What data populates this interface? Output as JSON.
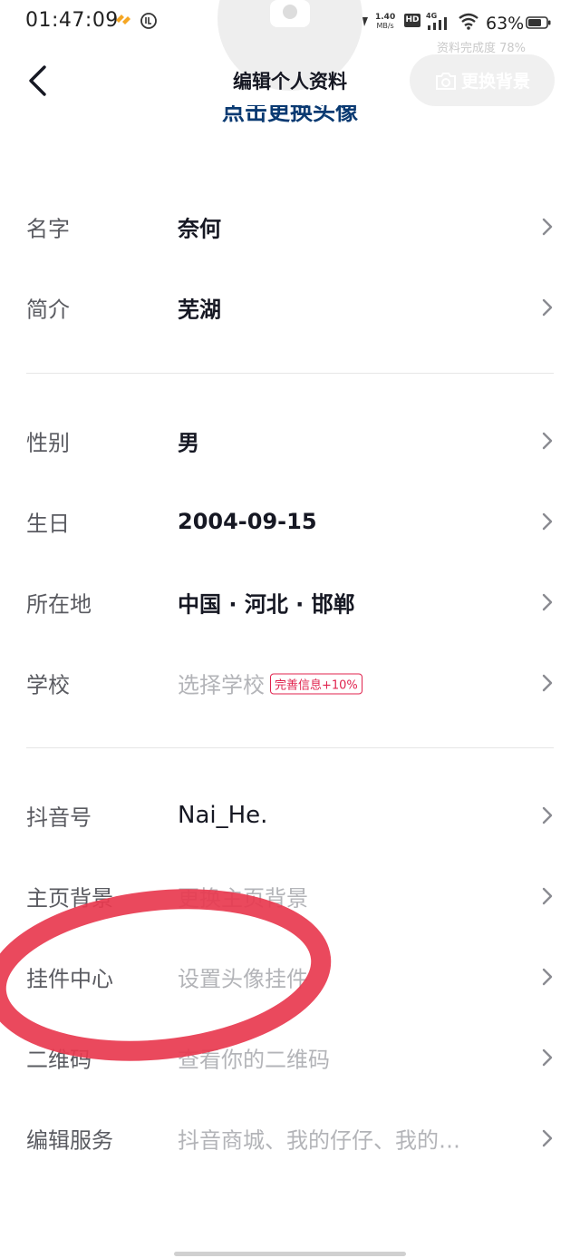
{
  "status_bar": {
    "time": "01:47:09",
    "net_speed_value": "1.40",
    "net_speed_unit": "MB/s",
    "hd": "HD",
    "net_type": "4G",
    "battery": "63%"
  },
  "header": {
    "title": "编辑个人资料",
    "change_bg_button": "更换背景",
    "completion": "资料完成度 78%",
    "change_avatar": "点击更换头像"
  },
  "profile": {
    "name": {
      "label": "名字",
      "value": "奈何"
    },
    "bio": {
      "label": "简介",
      "value": "芜湖"
    },
    "gender": {
      "label": "性别",
      "value": "男"
    },
    "birthday": {
      "label": "生日",
      "value": "2004-09-15"
    },
    "location": {
      "label": "所在地",
      "value": "中国 · 河北 · 邯郸"
    },
    "school": {
      "label": "学校",
      "placeholder": "选择学校",
      "badge": "完善信息+10%"
    },
    "douyin_id": {
      "label": "抖音号",
      "value": "Nai_He."
    },
    "home_bg": {
      "label": "主页背景",
      "placeholder": "更换主页背景"
    },
    "pendant": {
      "label": "挂件中心",
      "placeholder": "设置头像挂件"
    },
    "qrcode": {
      "label": "二维码",
      "placeholder": "查看你的二维码"
    },
    "services": {
      "label": "编辑服务",
      "placeholder": "抖音商城、我的仔仔、我的…"
    }
  },
  "colors": {
    "annotation_circle": "#e8394f",
    "badge": "#e0234e",
    "link": "#0a3a72"
  }
}
